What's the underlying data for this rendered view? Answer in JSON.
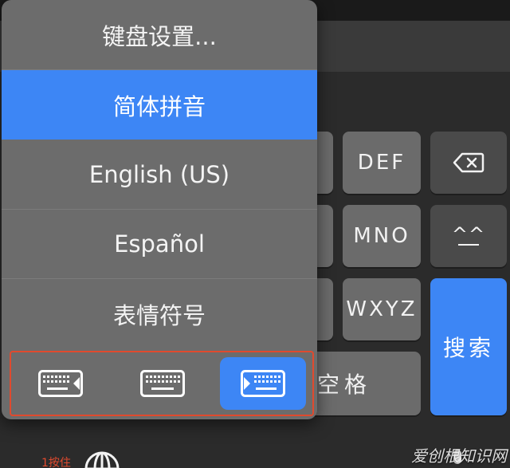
{
  "popup": {
    "menu_items": [
      {
        "label": "键盘设置..."
      },
      {
        "label": "简体拼音"
      },
      {
        "label": "English (US)"
      },
      {
        "label": "Español"
      },
      {
        "label": "表情符号"
      }
    ],
    "selected_index": 1
  },
  "keys": {
    "def": "DEF",
    "mno": "MNO",
    "emoticon": "^^",
    "wxyz": "WXYZ",
    "search": "搜索",
    "space": "空格"
  },
  "bottom": {
    "hint": "1按住"
  },
  "watermark": "爱创根知识网",
  "colors": {
    "accent": "#3d86f5",
    "highlight_border": "#e04a2e",
    "popup_bg": "#6c6c6c",
    "key_bg": "#6b6b6b",
    "keyboard_bg": "#2b2b2b"
  }
}
